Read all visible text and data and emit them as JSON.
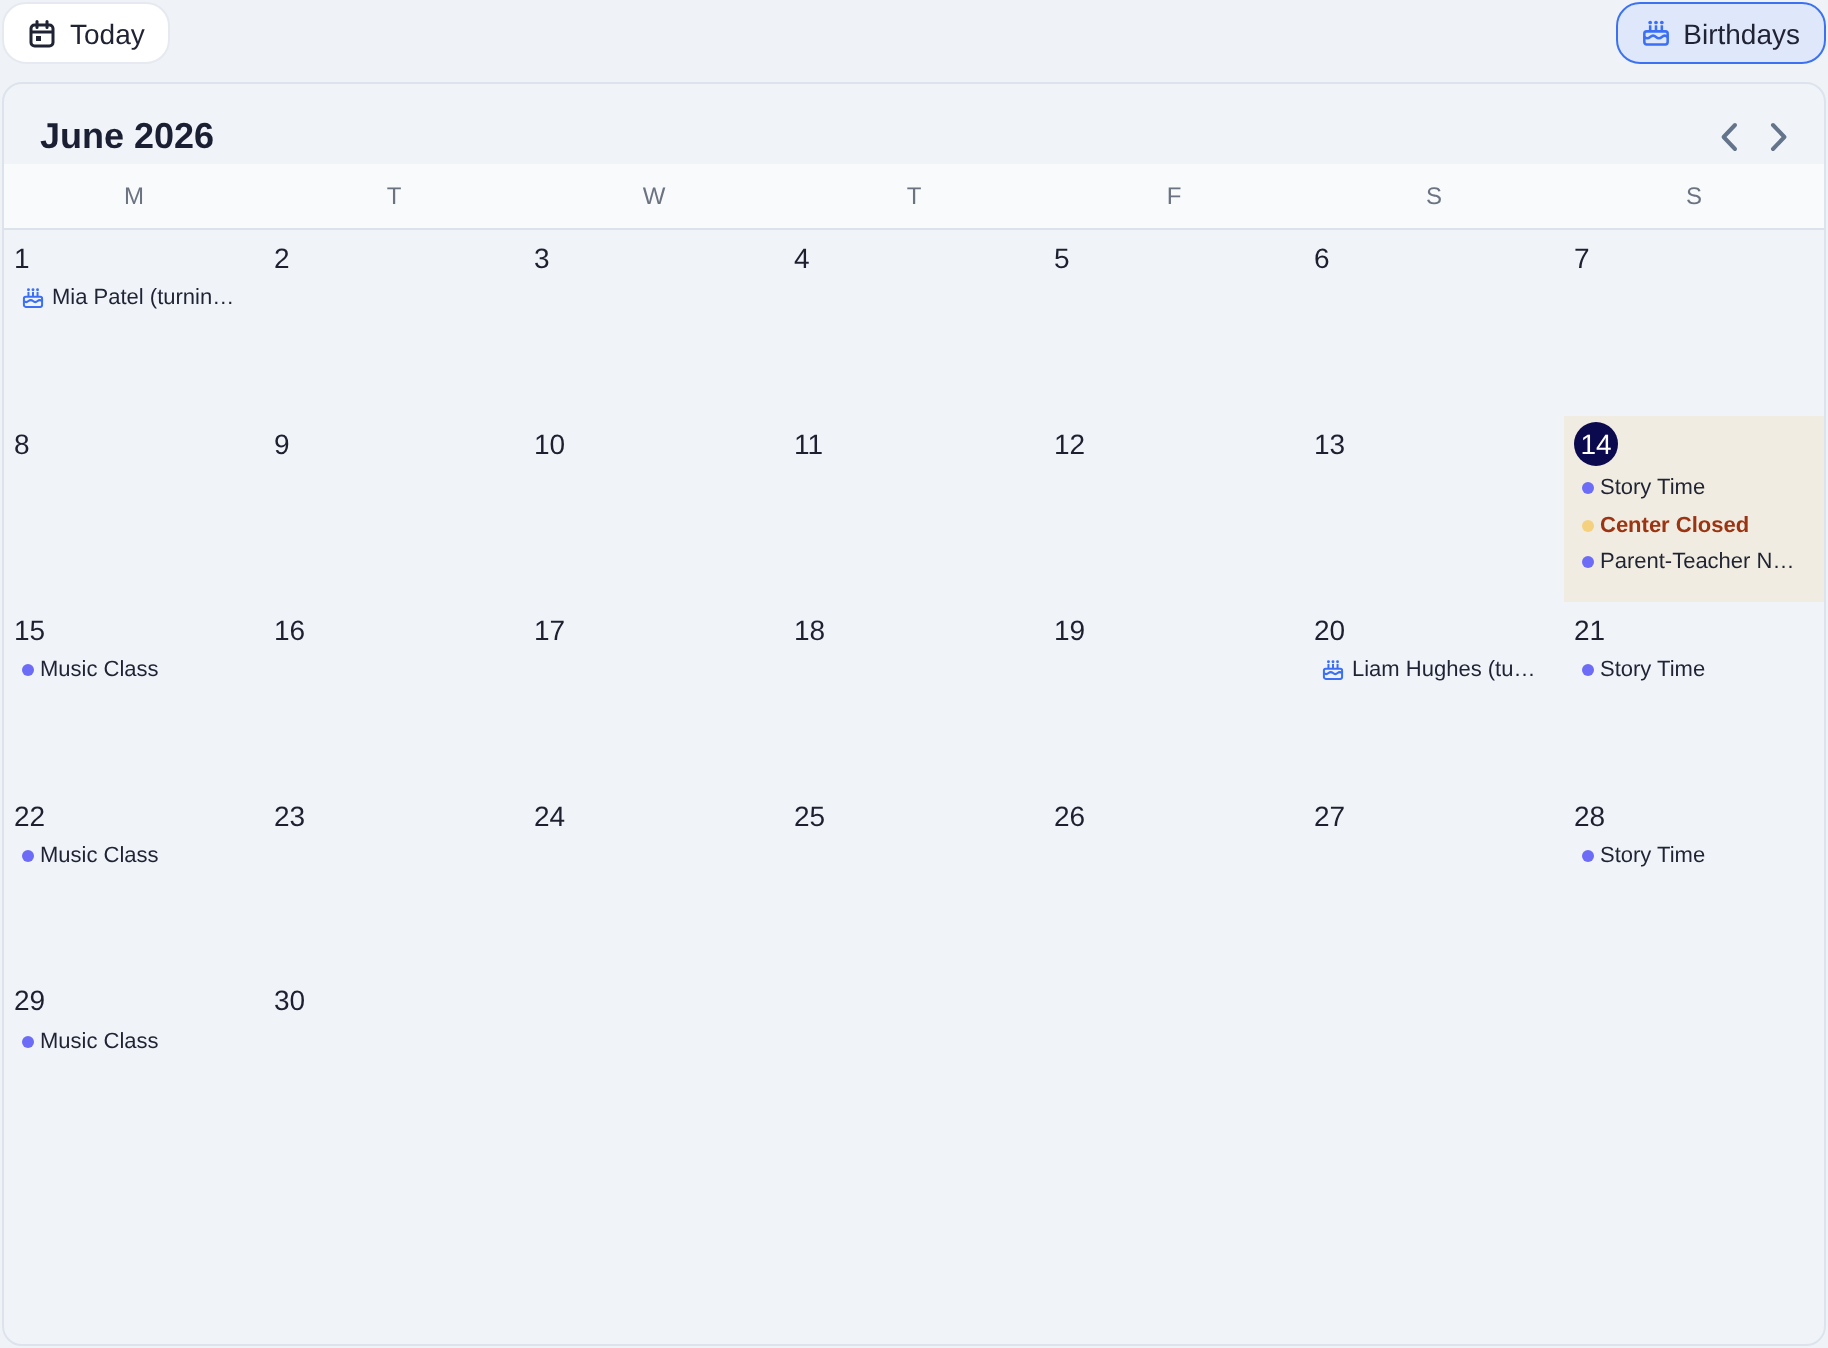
{
  "toolbar": {
    "today_button": {
      "label": "Today"
    },
    "birthdays_toggle": {
      "label": "Birthdays",
      "selected": true
    }
  },
  "calendar": {
    "title": "June 2026",
    "weekdays": [
      "M",
      "T",
      "W",
      "T",
      "F",
      "S",
      "S"
    ],
    "days": [
      {
        "number": "1",
        "today": false,
        "events": [
          {
            "kind": "birthday",
            "title": "Mia Patel (turnin…"
          }
        ]
      },
      {
        "number": "2",
        "today": false
      },
      {
        "number": "3",
        "today": false
      },
      {
        "number": "4",
        "today": false
      },
      {
        "number": "5",
        "today": false
      },
      {
        "number": "6",
        "today": false
      },
      {
        "number": "7",
        "today": false
      },
      {
        "number": "8",
        "today": false
      },
      {
        "number": "9",
        "today": false
      },
      {
        "number": "10",
        "today": false
      },
      {
        "number": "11",
        "today": false
      },
      {
        "number": "12",
        "today": false
      },
      {
        "number": "13",
        "today": false
      },
      {
        "number": "14",
        "today": true,
        "events": [
          {
            "kind": "event",
            "title": "Story Time",
            "color": "#6c6cf6"
          },
          {
            "kind": "closure",
            "title": "Center Closed",
            "color": "#f3d17e"
          },
          {
            "kind": "event",
            "title": "Parent-Teacher N…",
            "color": "#6c6cf6"
          }
        ]
      },
      {
        "number": "15",
        "today": false,
        "events": [
          {
            "kind": "event",
            "title": "Music Class",
            "color": "#6c6cf6"
          }
        ]
      },
      {
        "number": "16",
        "today": false
      },
      {
        "number": "17",
        "today": false
      },
      {
        "number": "18",
        "today": false
      },
      {
        "number": "19",
        "today": false
      },
      {
        "number": "20",
        "today": false,
        "events": [
          {
            "kind": "birthday",
            "title": "Liam Hughes (tu…"
          }
        ]
      },
      {
        "number": "21",
        "today": false,
        "events": [
          {
            "kind": "event",
            "title": "Story Time",
            "color": "#6c6cf6"
          }
        ]
      },
      {
        "number": "22",
        "today": false,
        "events": [
          {
            "kind": "event",
            "title": "Music Class",
            "color": "#6c6cf6"
          }
        ]
      },
      {
        "number": "23",
        "today": false
      },
      {
        "number": "24",
        "today": false
      },
      {
        "number": "25",
        "today": false
      },
      {
        "number": "26",
        "today": false
      },
      {
        "number": "27",
        "today": false
      },
      {
        "number": "28",
        "today": false,
        "events": [
          {
            "kind": "event",
            "title": "Story Time",
            "color": "#6c6cf6"
          }
        ]
      },
      {
        "number": "29",
        "today": false,
        "events": [
          {
            "kind": "event",
            "title": "Music Class",
            "color": "#6c6cf6"
          }
        ]
      },
      {
        "number": "30",
        "today": false
      }
    ]
  }
}
